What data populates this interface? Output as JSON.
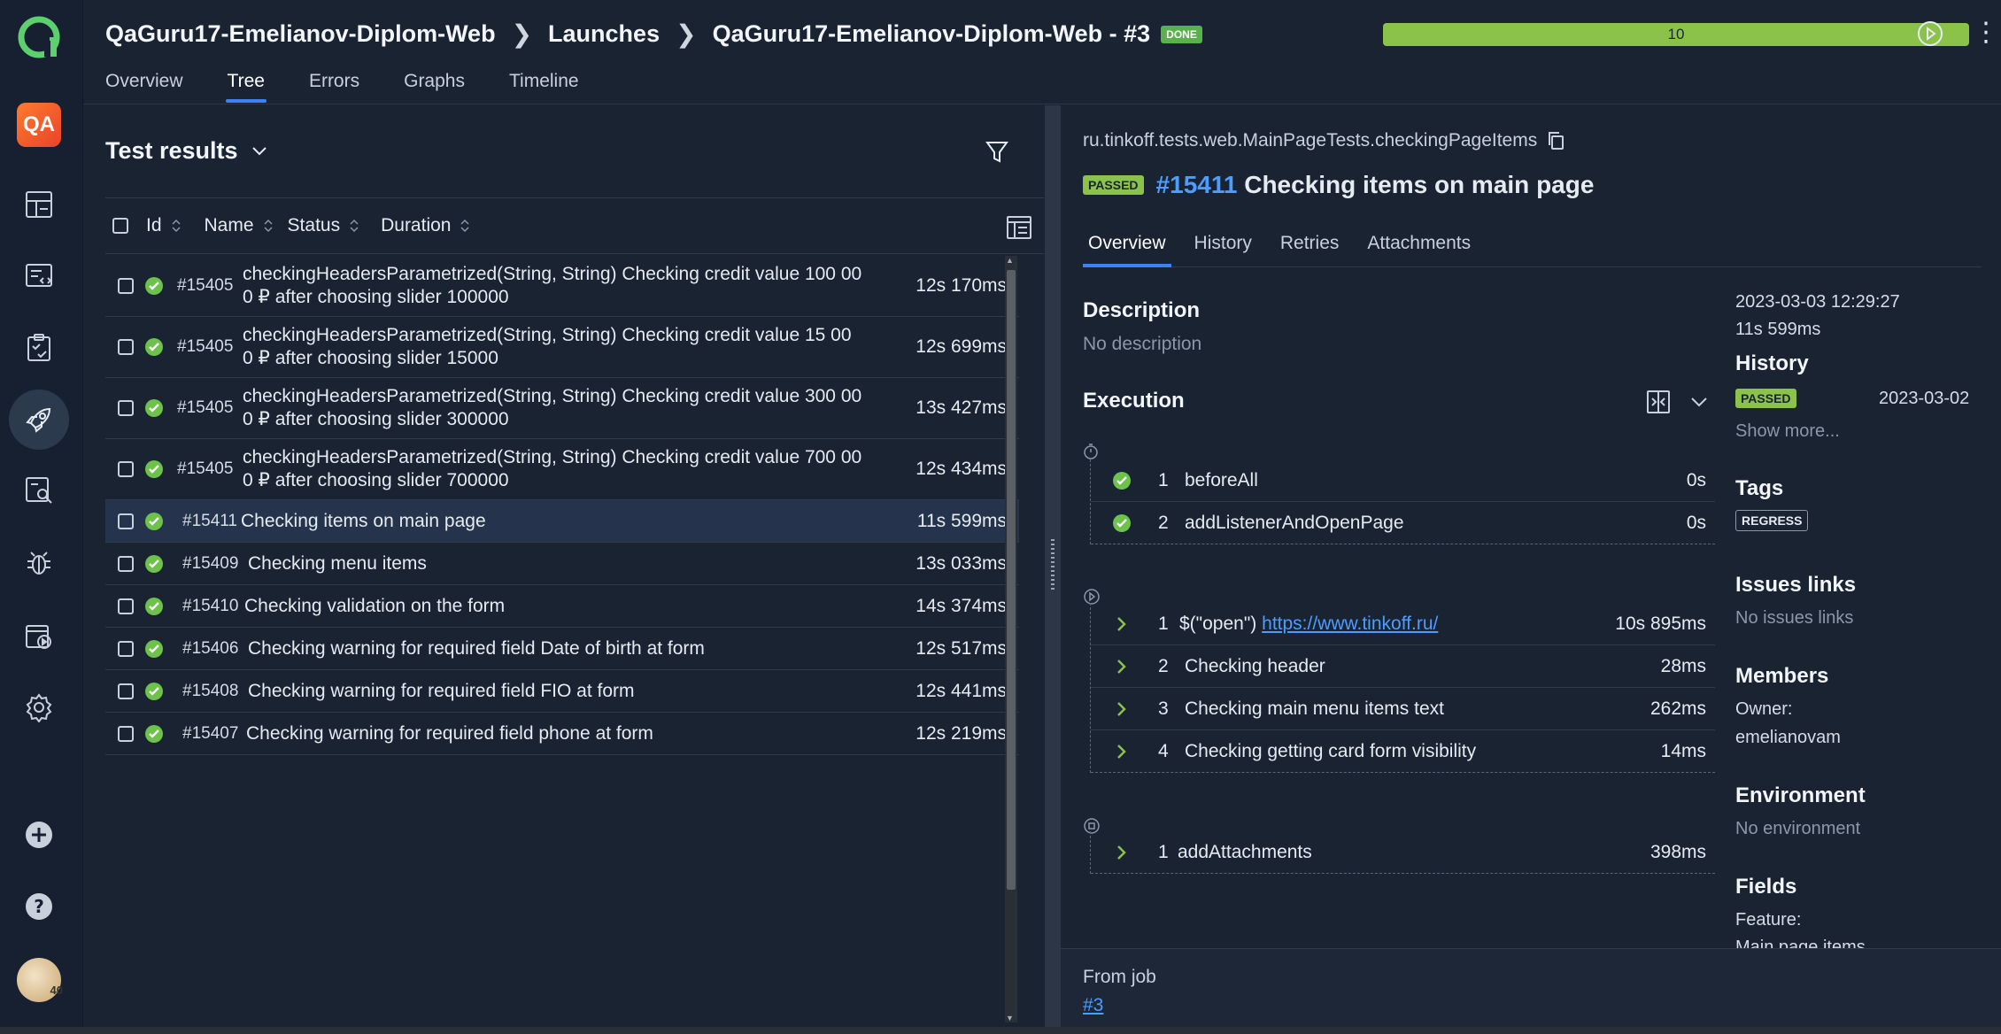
{
  "sidebar": {
    "qa_label": "QA",
    "avatar_badge": "40",
    "nav_icons": [
      "dashboard-icon",
      "launches-icon",
      "test-cases-icon",
      "rocket-icon",
      "search-analytics-icon",
      "bug-icon",
      "jobs-icon",
      "settings-icon"
    ]
  },
  "header": {
    "breadcrumb": [
      "QaGuru17-Emelianov-Diplom-Web",
      "Launches",
      "QaGuru17-Emelianov-Diplom-Web - #3"
    ],
    "done_badge": "DONE",
    "progress": "10",
    "tabs": [
      "Overview",
      "Tree",
      "Errors",
      "Graphs",
      "Timeline"
    ],
    "active_tab": "Tree"
  },
  "left": {
    "title": "Test results",
    "columns": [
      "Id",
      "Name",
      "Status",
      "Duration"
    ],
    "rows": [
      {
        "id": "#15405",
        "name1": "checkingHeadersParametrized(String, String) Checking credit value 100 00",
        "name2": "0 ₽ after choosing slider 100000",
        "duration": "12s 170ms"
      },
      {
        "id": "#15405",
        "name1": "checkingHeadersParametrized(String, String) Checking credit value 15 00",
        "name2": "0 ₽ after choosing slider 15000",
        "duration": "12s 699ms"
      },
      {
        "id": "#15405",
        "name1": "checkingHeadersParametrized(String, String) Checking credit value 300 00",
        "name2": "0 ₽ after choosing slider 300000",
        "duration": "13s 427ms"
      },
      {
        "id": "#15405",
        "name1": "checkingHeadersParametrized(String, String) Checking credit value 700 00",
        "name2": "0 ₽ after choosing slider 700000",
        "duration": "12s 434ms"
      },
      {
        "id": "#15411",
        "name1": "Checking items on main page",
        "duration": "11s 599ms"
      },
      {
        "id": "#15409",
        "name1": "Checking menu items",
        "duration": "13s 033ms"
      },
      {
        "id": "#15410",
        "name1": "Checking validation on the form",
        "duration": "14s 374ms"
      },
      {
        "id": "#15406",
        "name1": "Checking warning for required field Date of birth at form",
        "duration": "12s 517ms"
      },
      {
        "id": "#15408",
        "name1": "Checking warning for required field FIO at form",
        "duration": "12s 441ms"
      },
      {
        "id": "#15407",
        "name1": "Checking warning for required field phone at form",
        "duration": "12s 219ms"
      }
    ]
  },
  "right": {
    "full_name": "ru.tinkoff.tests.web.MainPageTests.checkingPageItems",
    "status_badge": "PASSED",
    "uid": "#15411",
    "title": "Checking items on main page",
    "tabs": [
      "Overview",
      "History",
      "Retries",
      "Attachments"
    ],
    "description_title": "Description",
    "description": "No description",
    "execution_title": "Execution",
    "setup_steps": [
      {
        "num": "1",
        "name": "beforeAll",
        "duration": "0s"
      },
      {
        "num": "2",
        "name": "addListenerAndOpenPage",
        "duration": "0s"
      }
    ],
    "body_steps": [
      {
        "num": "1",
        "name_prefix": "$(\"open\") ",
        "link": "https://www.tinkoff.ru/",
        "duration": "10s 895ms"
      },
      {
        "num": "2",
        "name": "Checking header",
        "duration": "28ms"
      },
      {
        "num": "3",
        "name": "Checking main menu items text",
        "duration": "262ms"
      },
      {
        "num": "4",
        "name": "Checking getting card form visibility",
        "duration": "14ms"
      }
    ],
    "teardown_steps": [
      {
        "num": "1",
        "name": "addAttachments",
        "duration": "398ms"
      }
    ],
    "side": {
      "date": "2023-03-03 12:29:27",
      "duration": "11s 599ms",
      "history_title": "History",
      "history_badge": "PASSED",
      "history_date": "2023-03-02",
      "show_more": "Show more...",
      "tags_title": "Tags",
      "tag": "REGRESS",
      "issues_title": "Issues links",
      "issues_value": "No issues links",
      "members_title": "Members",
      "owner_label": "Owner:",
      "owner": "emelianovam",
      "env_title": "Environment",
      "env_value": "No environment",
      "fields_title": "Fields",
      "feature_label": "Feature:",
      "feature_value": "Main page items"
    },
    "job_label": "From job",
    "job_link": "#3"
  },
  "colors": {
    "background": "#1a2332",
    "passed": "#8bc34a",
    "accent": "#3b82f6",
    "link": "#4d9cff"
  }
}
